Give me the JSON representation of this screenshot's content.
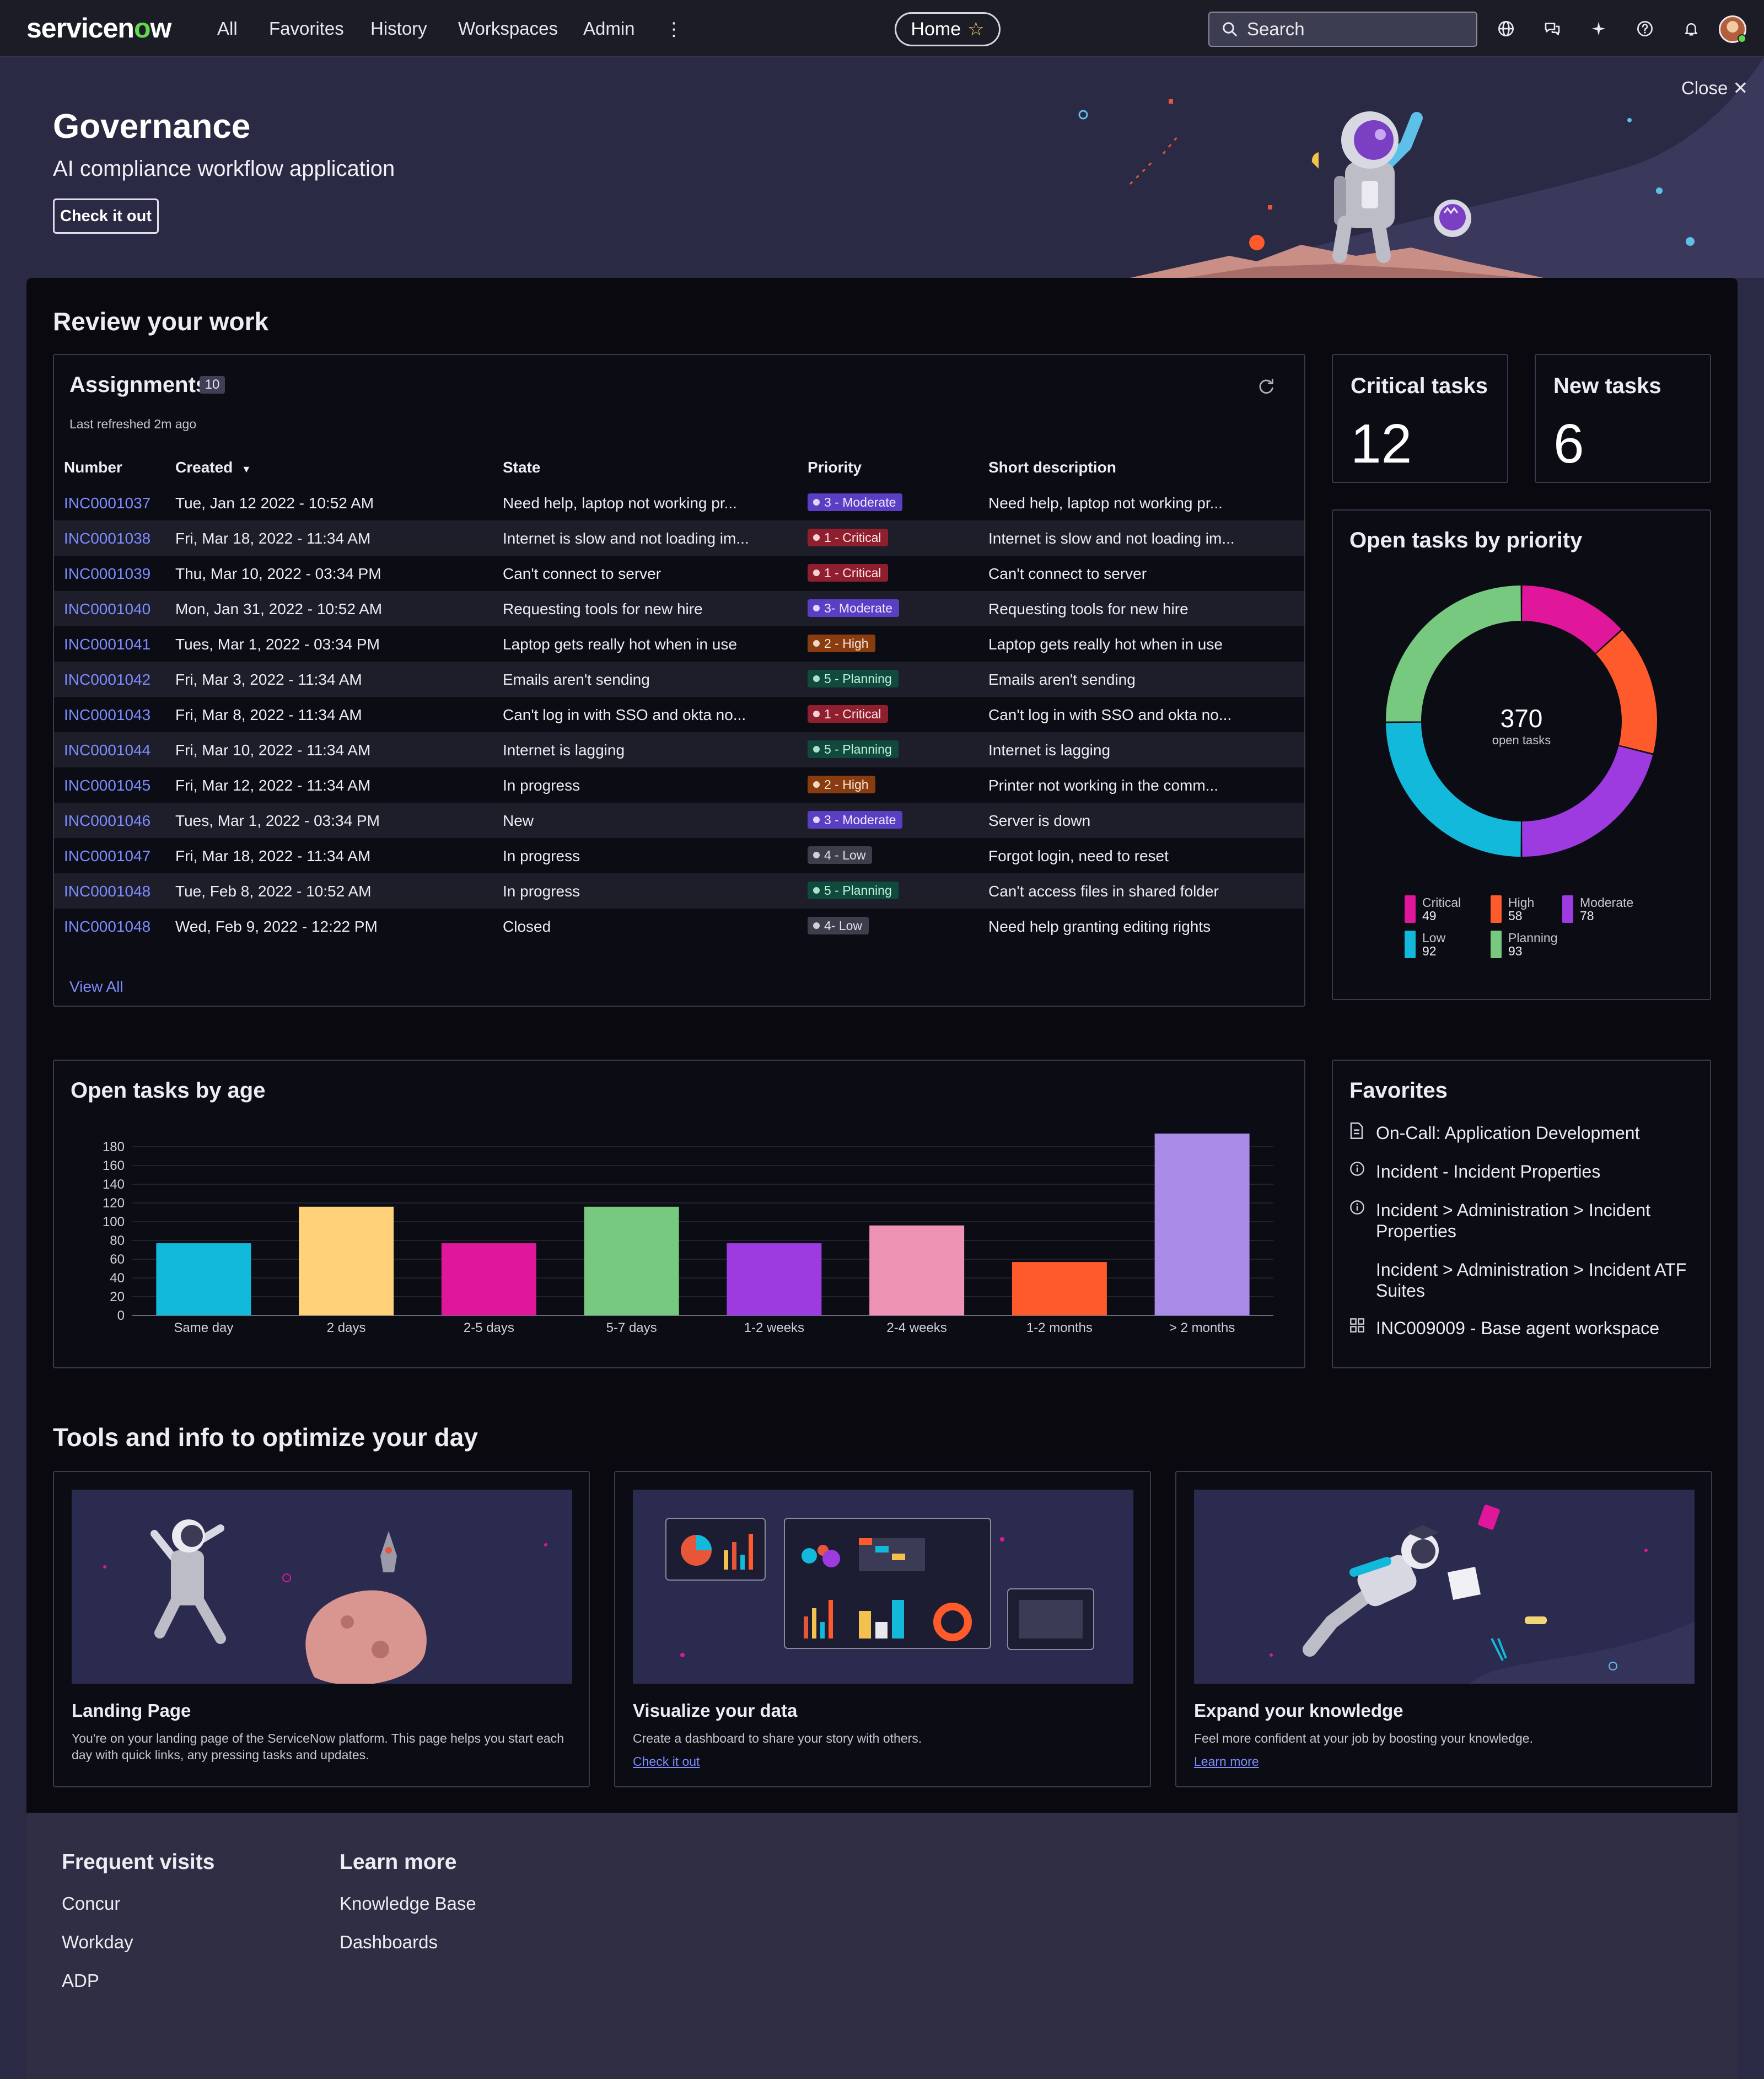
{
  "nav": {
    "logo_pre": "servicen",
    "logo_o": "o",
    "logo_post": "w",
    "links": [
      "All",
      "Favorites",
      "History",
      "Workspaces",
      "Admin"
    ],
    "more": "⋮",
    "home": "Home",
    "search_placeholder": "Search"
  },
  "hero": {
    "title": "Governance",
    "subtitle": "AI compliance workflow application",
    "button": "Check it out",
    "close": "Close"
  },
  "review": {
    "title": "Review your work"
  },
  "assignments": {
    "title": "Assignments",
    "count": "10",
    "last_refreshed": "Last refreshed 2m ago",
    "columns": {
      "number": "Number",
      "created": "Created",
      "state": "State",
      "priority": "Priority",
      "short_description": "Short description"
    },
    "rows": [
      {
        "number": "INC0001037",
        "created": "Tue, Jan 12 2022 - 10:52 AM",
        "state": "Need help, laptop not working pr...",
        "priority": "3 - Moderate",
        "level": "moderate",
        "desc": "Need help, laptop not working pr..."
      },
      {
        "number": "INC0001038",
        "created": "Fri, Mar 18, 2022 - 11:34 AM",
        "state": "Internet is slow and not loading im...",
        "priority": "1 - Critical",
        "level": "critical",
        "desc": "Internet is slow and not loading im..."
      },
      {
        "number": "INC0001039",
        "created": "Thu, Mar 10, 2022 - 03:34 PM",
        "state": "Can't connect to server",
        "priority": "1 - Critical",
        "level": "critical",
        "desc": "Can't connect to server"
      },
      {
        "number": "INC0001040",
        "created": "Mon, Jan 31, 2022 - 10:52 AM",
        "state": "Requesting tools for new hire",
        "priority": "3- Moderate",
        "level": "moderate",
        "desc": "Requesting tools for new hire"
      },
      {
        "number": "INC0001041",
        "created": "Tues, Mar 1, 2022 - 03:34 PM",
        "state": "Laptop gets really hot when in use",
        "priority": "2 - High",
        "level": "high",
        "desc": "Laptop gets really hot when in use"
      },
      {
        "number": "INC0001042",
        "created": "Fri, Mar 3, 2022 - 11:34 AM",
        "state": "Emails aren't sending",
        "priority": "5 - Planning",
        "level": "planning",
        "desc": "Emails aren't sending"
      },
      {
        "number": "INC0001043",
        "created": "Fri, Mar 8, 2022 - 11:34 AM",
        "state": "Can't log in with SSO and okta no...",
        "priority": "1 - Critical",
        "level": "critical",
        "desc": "Can't log in with SSO and okta no..."
      },
      {
        "number": "INC0001044",
        "created": "Fri, Mar 10, 2022 - 11:34 AM",
        "state": "Internet is lagging",
        "priority": "5 - Planning",
        "level": "planning",
        "desc": "Internet is lagging"
      },
      {
        "number": "INC0001045",
        "created": "Fri, Mar 12, 2022 - 11:34 AM",
        "state": "In progress",
        "priority": "2 - High",
        "level": "high",
        "desc": "Printer not working in the comm..."
      },
      {
        "number": "INC0001046",
        "created": "Tues, Mar 1, 2022 - 03:34 PM",
        "state": "New",
        "priority": "3 - Moderate",
        "level": "moderate",
        "desc": "Server is down"
      },
      {
        "number": "INC0001047",
        "created": "Fri, Mar 18, 2022 - 11:34 AM",
        "state": "In progress",
        "priority": "4 - Low",
        "level": "low",
        "desc": "Forgot login, need to reset"
      },
      {
        "number": "INC0001048",
        "created": "Tue, Feb 8, 2022 - 10:52 AM",
        "state": "In progress",
        "priority": "5 - Planning",
        "level": "planning",
        "desc": "Can't access files in shared folder"
      },
      {
        "number": "INC0001048",
        "created": "Wed, Feb 9, 2022 - 12:22 PM",
        "state": "Closed",
        "priority": "4- Low",
        "level": "low",
        "desc": "Need help granting editing rights"
      }
    ],
    "view_all": "View All"
  },
  "stats": {
    "critical": {
      "title": "Critical tasks",
      "value": "12"
    },
    "new": {
      "title": "New tasks",
      "value": "6"
    }
  },
  "priority_chart": {
    "title": "Open tasks by priority",
    "total": "370",
    "total_label": "open tasks"
  },
  "age_chart": {
    "title": "Open tasks by age"
  },
  "chart_data": [
    {
      "type": "pie",
      "title": "Open tasks by priority",
      "categories": [
        "Critical",
        "High",
        "Moderate",
        "Low",
        "Planning"
      ],
      "values": [
        49,
        58,
        78,
        92,
        93
      ],
      "colors": [
        "#e0169b",
        "#ff5a2b",
        "#9d3be0",
        "#12b9db",
        "#76c97f"
      ],
      "legend": "bottom"
    },
    {
      "type": "bar",
      "title": "Open tasks by age",
      "categories": [
        "Same day",
        "2 days",
        "2-5 days",
        "5-7 days",
        "1-2 weeks",
        "2-4 weeks",
        "1-2 months",
        "> 2 months"
      ],
      "values": [
        77,
        116,
        77,
        116,
        77,
        96,
        57,
        194
      ],
      "colors": [
        "#12b9db",
        "#ffd27a",
        "#e0169b",
        "#76c97f",
        "#9d3be0",
        "#ee93b3",
        "#ff5a2b",
        "#a98ce8"
      ],
      "ylim": [
        0,
        180
      ],
      "yticks": [
        0,
        20,
        40,
        60,
        80,
        100,
        120,
        140,
        160,
        180
      ],
      "grid": true
    }
  ],
  "favorites": {
    "title": "Favorites",
    "items": [
      {
        "icon": "document-icon",
        "label": "On-Call: Application Development"
      },
      {
        "icon": "info-icon",
        "label": "Incident - Incident Properties"
      },
      {
        "icon": "info-icon",
        "label": "Incident > Administration > Incident Properties"
      },
      {
        "icon": "none",
        "label": "Incident > Administration > Incident ATF Suites"
      },
      {
        "icon": "grid-icon",
        "label": "INC009009 - Base agent workspace"
      }
    ]
  },
  "tools": {
    "title": "Tools and info to optimize your day",
    "cards": [
      {
        "name": "Landing Page",
        "desc": "You're on your landing page of the ServiceNow platform. This page helps you start each day with quick links, any pressing tasks and updates.",
        "link": ""
      },
      {
        "name": "Visualize your data",
        "desc": "Create a dashboard to share your story with others.",
        "link": "Check it out"
      },
      {
        "name": "Expand your knowledge",
        "desc": "Feel more confident at your job by boosting your knowledge.",
        "link": "Learn more"
      }
    ]
  },
  "footer": {
    "frequent_title": "Frequent visits",
    "frequent": [
      "Concur",
      "Workday",
      "ADP"
    ],
    "learn_title": "Learn more",
    "learn": [
      "Knowledge Base",
      "Dashboards"
    ]
  },
  "colors": {
    "link": "#7d8cff",
    "brand_green": "#62d84e",
    "panel": "#09090f",
    "hero_bg": "#2b2a45"
  }
}
